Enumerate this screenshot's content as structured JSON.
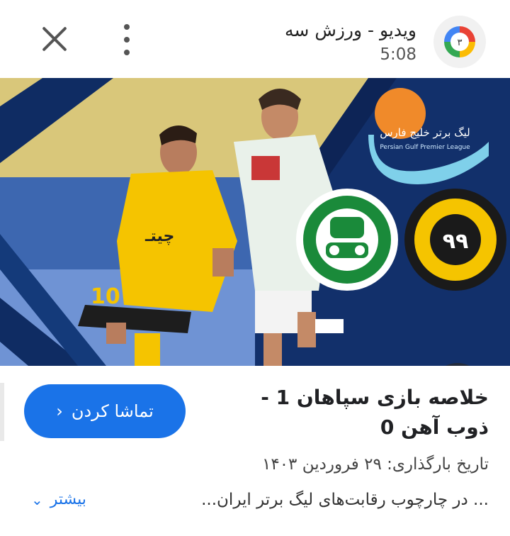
{
  "header": {
    "channel_title": "ویدیو - ورزش سه",
    "duration": "5:08",
    "close_icon": "close-icon",
    "more_icon": "more-vertical-icon"
  },
  "media": {
    "league_logo_text": "لیگ برتر خلیج فارس",
    "league_logo_subtext": "Persian Gulf Premier League",
    "lens_icon": "image-search-icon",
    "colors": {
      "background_blue": "#1a3a75",
      "sepahan_yellow": "#f5c400",
      "zobahan_green": "#1a8a3a"
    }
  },
  "actions": {
    "watch_label": "تماشا کردن",
    "more_label": "بیشتر"
  },
  "video": {
    "title": "خلاصه بازی سپاهان 1 - ذوب آهن 0",
    "upload_date": "تاریخ بارگذاری: ۲۹ فروردین ۱۴۰۳",
    "description": "... در چارچوب رقابت‌های لیگ برتر ایران..."
  }
}
